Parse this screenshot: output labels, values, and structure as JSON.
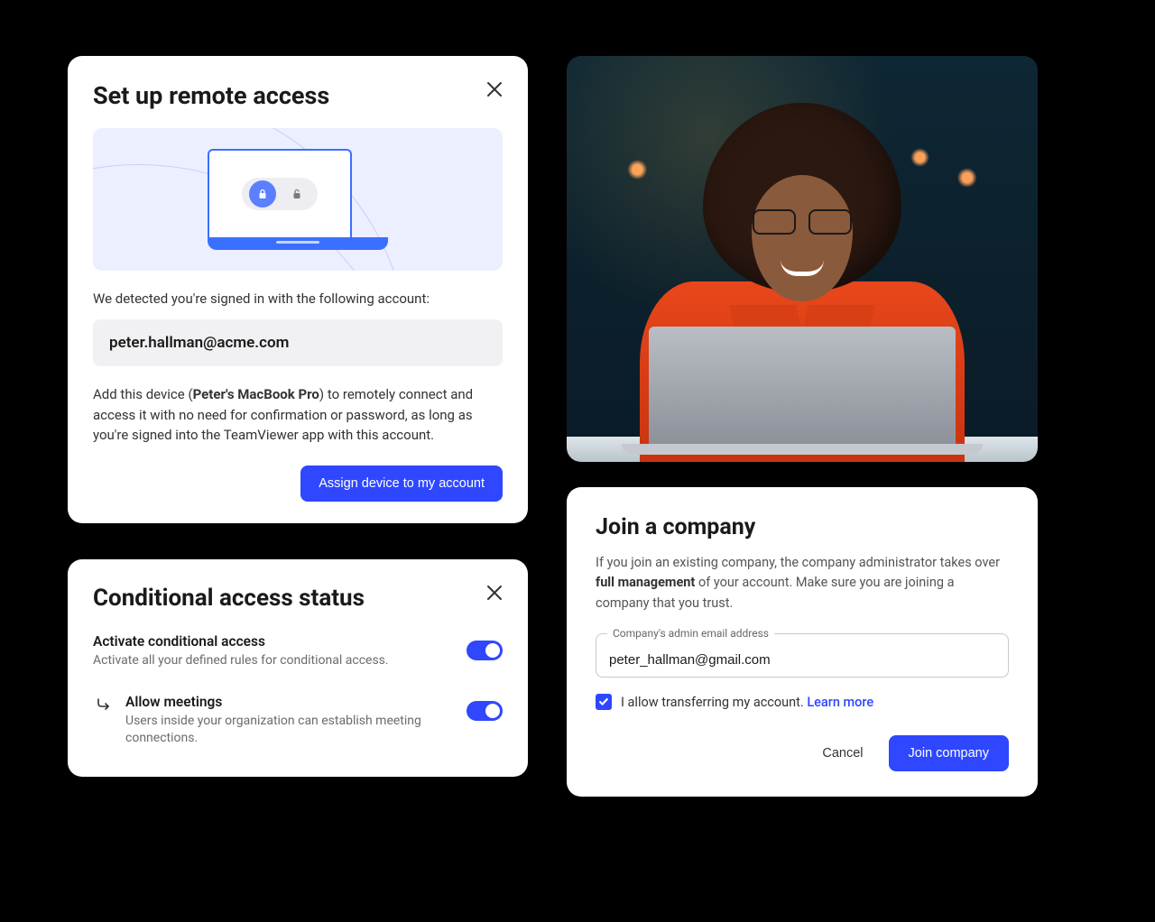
{
  "remote": {
    "title": "Set up remote access",
    "detected_text": "We detected you're signed in with the following account:",
    "email": "peter.hallman@acme.com",
    "desc_prefix": "Add this device (",
    "device_name": "Peter's MacBook Pro",
    "desc_suffix": ") to remotely connect and access it with no need for confirmation or password, as long as you're signed into the TeamViewer app with this account.",
    "assign_button": "Assign device to my account"
  },
  "conditional": {
    "title": "Conditional access status",
    "activate_title": "Activate conditional access",
    "activate_sub": "Activate all your defined rules for conditional access.",
    "allow_title": "Allow meetings",
    "allow_sub": "Users inside your organization can establish meeting connections."
  },
  "join": {
    "title": "Join a company",
    "desc_prefix": "If you join an existing company, the company administrator takes over ",
    "desc_bold": "full management",
    "desc_suffix": " of your account. Make sure you are joining a company that you trust.",
    "input_label": "Company's admin email address",
    "input_value": "peter_hallman@gmail.com",
    "checkbox_label": "I allow transferring my account. ",
    "learn_more": "Learn more",
    "cancel": "Cancel",
    "join_button": "Join company"
  }
}
